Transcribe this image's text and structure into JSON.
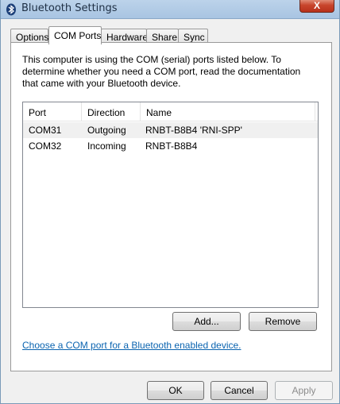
{
  "window": {
    "title": "Bluetooth Settings",
    "close_label": "X"
  },
  "tabs": [
    {
      "label": "Options"
    },
    {
      "label": "COM Ports"
    },
    {
      "label": "Hardware"
    },
    {
      "label": "Share"
    },
    {
      "label": "Sync"
    }
  ],
  "active_tab": "COM Ports",
  "description": "This computer is using the COM (serial) ports listed below. To determine whether you need a COM port, read the documentation that came with your Bluetooth device.",
  "ports_table": {
    "columns": [
      "Port",
      "Direction",
      "Name"
    ],
    "rows": [
      {
        "port": "COM31",
        "direction": "Outgoing",
        "name": "RNBT-B8B4 'RNI-SPP'"
      },
      {
        "port": "COM32",
        "direction": "Incoming",
        "name": "RNBT-B8B4"
      }
    ]
  },
  "buttons": {
    "add": "Add...",
    "remove": "Remove",
    "ok": "OK",
    "cancel": "Cancel",
    "apply": "Apply"
  },
  "help_link": "Choose a COM port for a Bluetooth enabled device."
}
